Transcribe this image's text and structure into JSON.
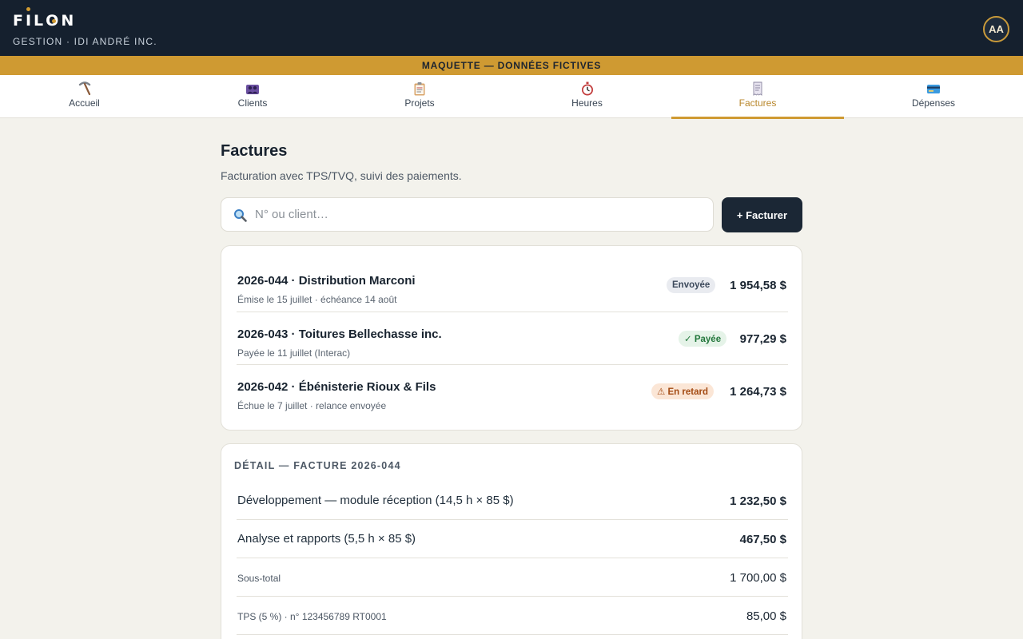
{
  "app": {
    "logo": "FILON",
    "subtitle": "GESTION · IDI ANDRÉ INC.",
    "avatar_initials": "AA"
  },
  "banner": "MAQUETTE — DONNÉES FICTIVES",
  "tabs": [
    {
      "label": "Accueil",
      "icon": "pickaxe-icon"
    },
    {
      "label": "Clients",
      "icon": "people-icon"
    },
    {
      "label": "Projets",
      "icon": "clipboard-icon"
    },
    {
      "label": "Heures",
      "icon": "stopwatch-icon"
    },
    {
      "label": "Factures",
      "icon": "receipt-icon",
      "active": true
    },
    {
      "label": "Dépenses",
      "icon": "credit-card-icon"
    }
  ],
  "page": {
    "title": "Factures",
    "subtitle": "Facturation avec TPS/TVQ, suivi des paiements."
  },
  "search": {
    "placeholder": "N° ou client…",
    "value": ""
  },
  "add_button": "+ Facturer",
  "invoices": [
    {
      "title": "2026-044 · Distribution Marconi",
      "meta": "Émise le 15 juillet · échéance 14 août",
      "status": "Envoyée",
      "amount": "1 954,58 $"
    },
    {
      "title": "2026-043 · Toitures Bellechasse inc.",
      "meta": "Payée le 11 juillet (Interac)",
      "status": "✓ Payée",
      "amount": "977,29 $"
    },
    {
      "title": "2026-042 · Ébénisterie Rioux & Fils",
      "meta": "Échue le 7 juillet · relance envoyée",
      "status": "⚠ En retard",
      "amount": "1 264,73 $"
    }
  ],
  "detail": {
    "heading": "DÉTAIL — FACTURE 2026-044",
    "lines": [
      {
        "label": "Développement — module réception (14,5 h × 85 $)",
        "value": "1 232,50 $"
      },
      {
        "label": "Analyse et rapports (5,5 h × 85 $)",
        "value": "467,50 $"
      },
      {
        "label": "Sous-total",
        "value": "1 700,00 $"
      },
      {
        "label": "TPS (5 %) · n° 123456789 RT0001",
        "value": "85,00 $"
      }
    ]
  },
  "colors": {
    "header_bg": "#15202e",
    "accent": "#cf9a32",
    "page_bg": "#f3f2ec",
    "primary_button": "#1b2735"
  }
}
